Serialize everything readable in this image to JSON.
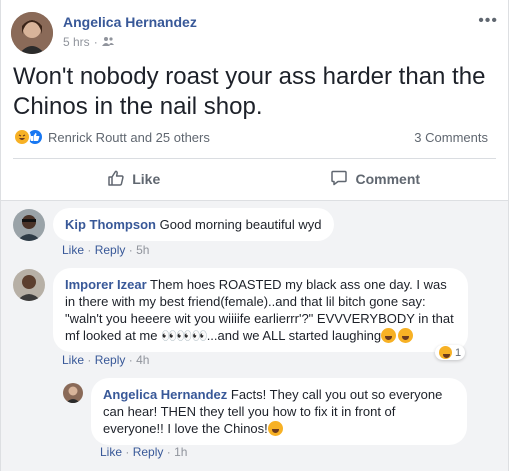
{
  "post": {
    "author": "Angelica Hernandez",
    "time": "5 hrs",
    "audience_icon": "friends-icon",
    "text": "Won't nobody roast your ass harder than the Chinos in the nail shop.",
    "reactions_text": "Renrick Routt and 25 others",
    "comments_count": "3 Comments",
    "like_label": "Like",
    "comment_label": "Comment"
  },
  "comments": [
    {
      "author": "Kip Thompson",
      "text": "Good morning beautiful wyd",
      "like": "Like",
      "reply": "Reply",
      "time": "5h"
    },
    {
      "author": "Imporer Izear",
      "text": "Them hoes ROASTED my black ass one day. I was in there with my best friend(female)..and that lil bitch gone say: \"waln't you heeere wit you wiiiife earlierrr'?\" EVVVERYBODY in that mf looked at me",
      "text_tail": "...and we ALL started laughing",
      "reaction_count": "1",
      "like": "Like",
      "reply": "Reply",
      "time": "4h"
    },
    {
      "author": "Angelica Hernandez",
      "text": "Facts! They call you out so everyone can hear! THEN they tell you how to fix it in front of everyone!! I love the Chinos!",
      "like": "Like",
      "reply": "Reply",
      "time": "1h"
    }
  ],
  "colors": {
    "link": "#385898",
    "meta": "#90949c",
    "like_blue": "#1877f2",
    "haha_yellow": "#f7b125"
  }
}
